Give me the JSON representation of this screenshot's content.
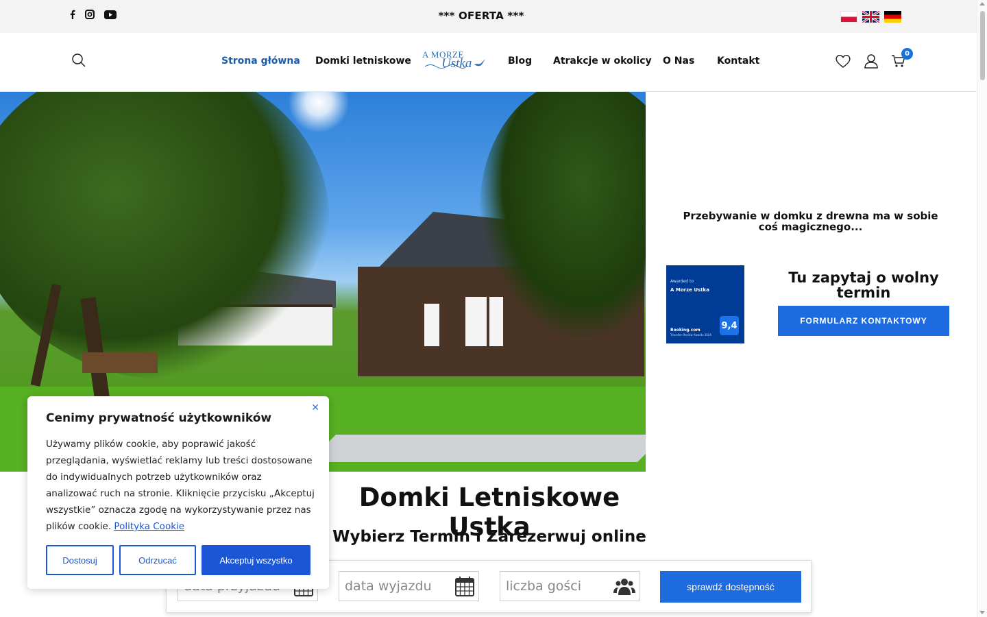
{
  "topbar": {
    "social_icons": [
      "facebook-icon",
      "instagram-icon",
      "youtube-icon"
    ],
    "offer_label": "*** OFERTA ***",
    "flags": [
      "flag-pl-icon",
      "flag-uk-icon",
      "flag-de-icon"
    ]
  },
  "nav": {
    "items": [
      {
        "label": "Strona główna",
        "active": true
      },
      {
        "label": "Domki letniskowe"
      },
      {
        "label": "Blog"
      },
      {
        "label": "Atrakcje w okolicy"
      },
      {
        "label": "O Nas"
      },
      {
        "label": "Kontakt"
      }
    ],
    "logo": {
      "line1": "A MORZE",
      "line2": "Ustka"
    },
    "cart_count": "0",
    "accent_color": "#1b5aa8"
  },
  "aside": {
    "tagline": "Przebywanie w domku z drewna ma w sobie coś magicznego...",
    "award": {
      "awarded_to": "Awarded to",
      "name": "A Morze Ustka",
      "brand": "Booking.com",
      "program": "Traveller Review Awards 2024",
      "score": "9,4"
    },
    "ask_title": "Tu zapytaj o wolny termin",
    "form_button": "FORMULARZ KONTAKTOWY"
  },
  "main": {
    "title": "Domki Letniskowe Ustka",
    "subtitle": "Wybierz Termin i Zarezerwuj online"
  },
  "booking": {
    "arrival_placeholder": "data przyjazdu",
    "departure_placeholder": "data wyjazdu",
    "guests_placeholder": "liczba gości",
    "check_button": "sprawdź dostępność"
  },
  "cookie": {
    "title": "Cenimy prywatność użytkowników",
    "text": "Używamy plików cookie, aby poprawić jakość przeglądania, wyświetlać reklamy lub treści dostosowane do indywidualnych potrzeb użytkowników oraz analizować ruch na stronie. Kliknięcie przycisku „Akceptuj wszystkie” oznacza zgodę na wykorzystywanie przez nas plików cookie.",
    "policy_link": "Polityka Cookie",
    "btn_customize": "Dostosuj",
    "btn_reject": "Odrzucać",
    "btn_accept": "Akceptuj wszystko",
    "accent_color": "#1a56d6"
  }
}
